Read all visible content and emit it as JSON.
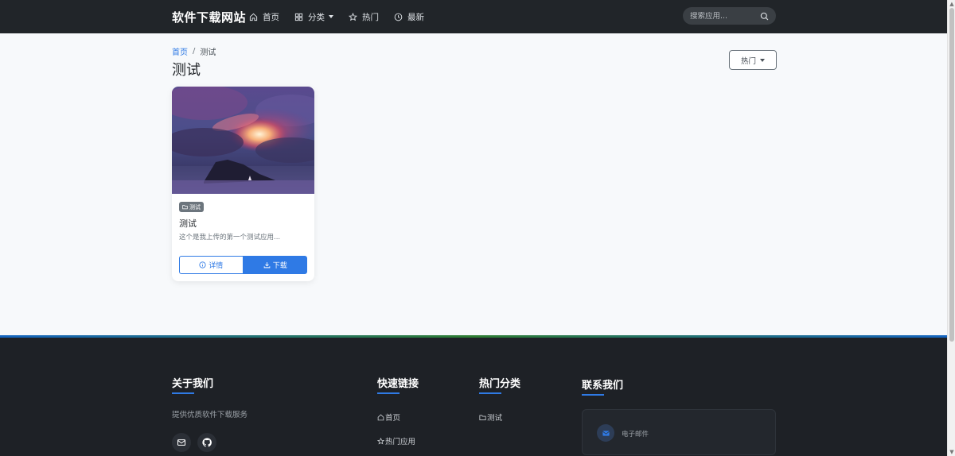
{
  "navbar": {
    "brand": "软件下载网站",
    "items": [
      {
        "label": "首页",
        "icon": "home-icon"
      },
      {
        "label": "分类",
        "icon": "grid-icon",
        "dropdown": true
      },
      {
        "label": "热门",
        "icon": "star-icon"
      },
      {
        "label": "最新",
        "icon": "clock-icon"
      }
    ],
    "search_placeholder": "搜索应用..."
  },
  "breadcrumb": {
    "home": "首页",
    "separator": "/",
    "current": "测试"
  },
  "page": {
    "title": "测试",
    "sort_label": "热门"
  },
  "apps": [
    {
      "badge": "测试",
      "title": "测试",
      "description": "这个是我上传的第一个测试应用...",
      "detail_label": "详情",
      "download_label": "下载"
    }
  ],
  "footer": {
    "about": {
      "heading": "关于我们",
      "text": "提供优质软件下载服务"
    },
    "quick_links": {
      "heading": "快速链接",
      "items": [
        "首页",
        "热门应用"
      ]
    },
    "popular_categories": {
      "heading": "热门分类",
      "items": [
        "测试"
      ]
    },
    "contact": {
      "heading": "联系我们",
      "email_label": "电子邮件"
    }
  },
  "colors": {
    "navbar_bg": "#212529",
    "accent": "#2f7ae5",
    "footer_bg": "#1e2126",
    "page_bg": "#f7f9fb"
  }
}
